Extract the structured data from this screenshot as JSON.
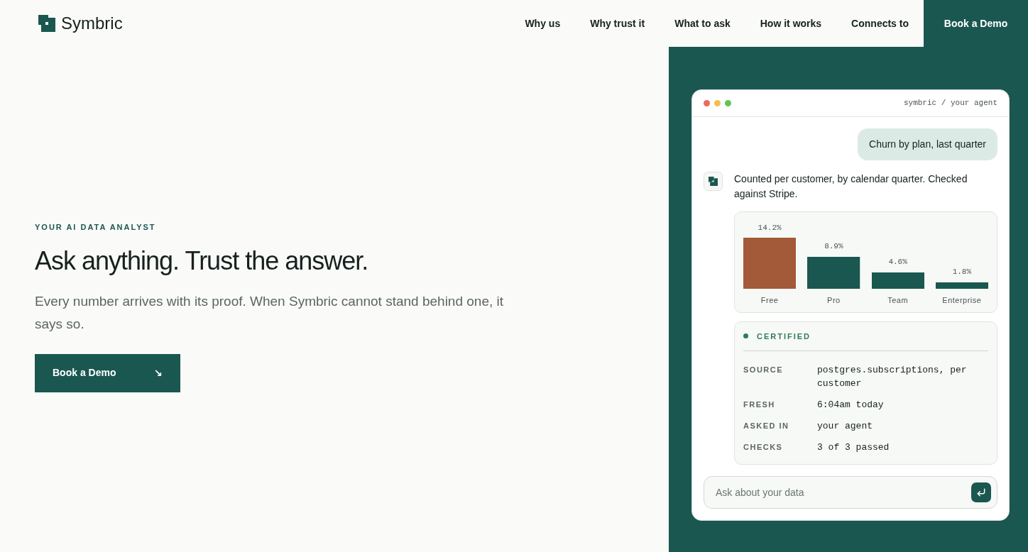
{
  "header": {
    "logo": "Symbric",
    "nav": [
      "Why us",
      "Why trust it",
      "What to ask",
      "How it works",
      "Connects to"
    ],
    "cta": "Book a Demo"
  },
  "hero": {
    "eyebrow": "YOUR AI DATA ANALYST",
    "title": "Ask anything. Trust the answer.",
    "body": "Every number arrives with its proof. When Symbric cannot stand behind one, it says so.",
    "button": "Book a Demo",
    "button_arrow": "↘"
  },
  "chat": {
    "path": "symbric / your agent",
    "user_message": "Churn by plan, last quarter",
    "reply": "Counted per customer, by calendar quarter. Checked against Stripe.",
    "chart": {
      "chart_data": {
        "type": "bar",
        "categories": [
          "Free",
          "Pro",
          "Team",
          "Enterprise"
        ],
        "series": [
          {
            "color": "#a35a38",
            "values": [
              14.2,
              null,
              null,
              null
            ],
            "value_labels": [
              "14.2%",
              null,
              null,
              null
            ]
          },
          {
            "color": "#1a5750",
            "values": [
              null,
              8.9,
              4.6,
              1.8
            ],
            "value_labels": [
              null,
              "8.9%",
              "4.6%",
              "1.8%"
            ]
          }
        ]
      }
    },
    "certificate": {
      "status": "CERTIFIED",
      "color": "#2e7d57",
      "rows": [
        {
          "label": "SOURCE",
          "value": "postgres.subscriptions, per customer"
        },
        {
          "label": "FRESH",
          "value": "6:04am today"
        },
        {
          "label": "ASKED IN",
          "value": "your agent"
        },
        {
          "label": "CHECKS",
          "value": "3 of 3 passed"
        }
      ]
    },
    "input": {
      "placeholder": "Ask about your data"
    }
  }
}
